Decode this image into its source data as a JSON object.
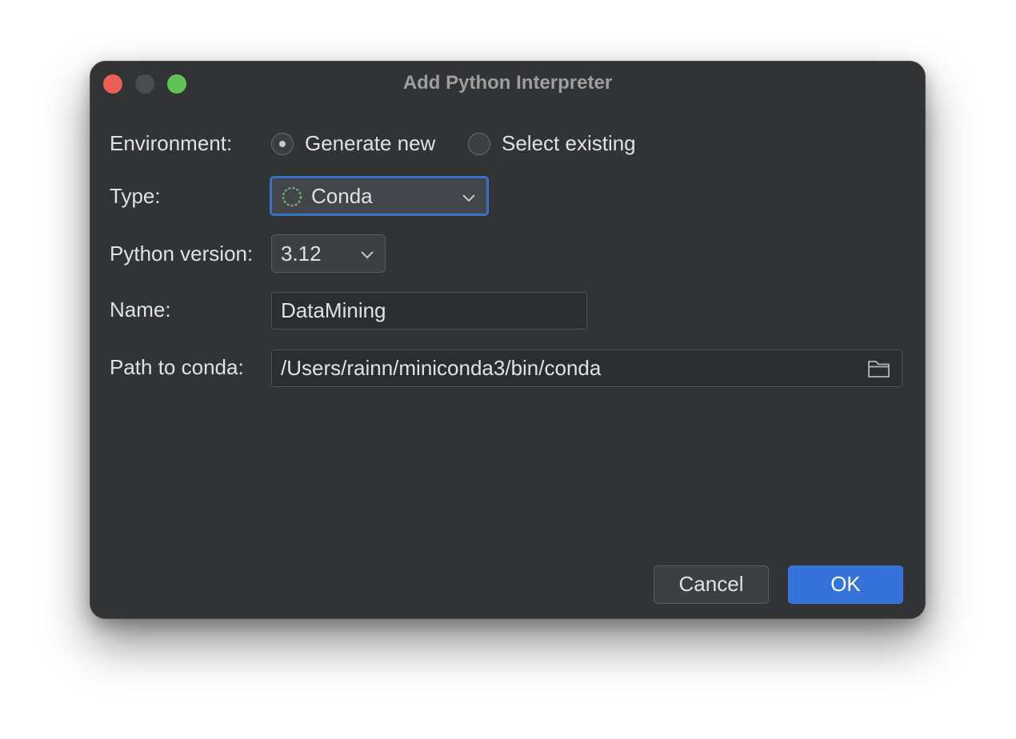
{
  "window": {
    "title": "Add Python Interpreter"
  },
  "environment": {
    "label": "Environment:",
    "options": [
      {
        "label": "Generate new",
        "selected": true
      },
      {
        "label": "Select existing",
        "selected": false
      }
    ]
  },
  "type": {
    "label": "Type:",
    "value": "Conda",
    "icon": "conda-icon",
    "icon_color": "#6aab73"
  },
  "python_version": {
    "label": "Python version:",
    "value": "3.12"
  },
  "name": {
    "label": "Name:",
    "value": "DataMining"
  },
  "path_to_conda": {
    "label": "Path to conda:",
    "value": "/Users/rainn/miniconda3/bin/conda",
    "icon": "folder-icon"
  },
  "buttons": {
    "cancel": "Cancel",
    "ok": "OK"
  },
  "colors": {
    "window_bg": "#323334",
    "accent": "#3574c4",
    "primary_button": "#3573db",
    "close": "#ec5f57",
    "minimize": "#4b4c4d",
    "maximize": "#5fc454"
  }
}
